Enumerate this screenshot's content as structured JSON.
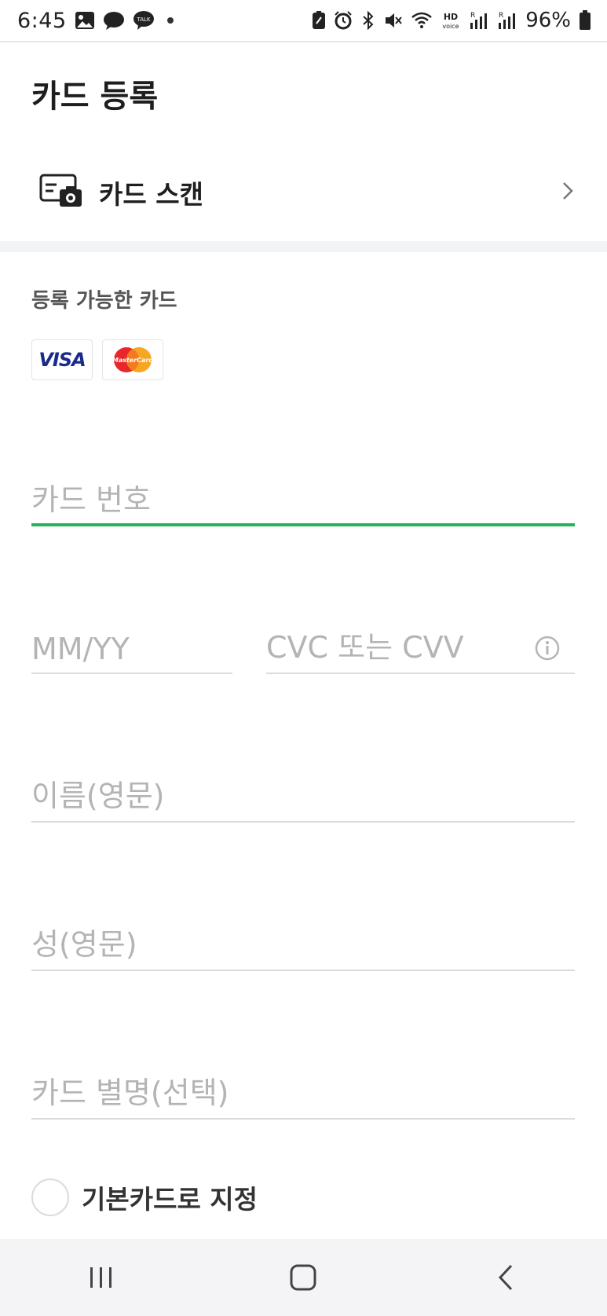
{
  "status_bar": {
    "time": "6:45",
    "battery_percent": "96%",
    "icons_left": [
      "gallery-icon",
      "chat-bubble-icon",
      "kakaotalk-icon"
    ],
    "kakaotalk_label": "TALK",
    "icons_right": [
      "phone-manager-icon",
      "alarm-icon",
      "bluetooth-icon",
      "mute-icon",
      "wifi-icon",
      "hd-voice-icon",
      "signal-icon",
      "signal-icon",
      "battery-icon"
    ],
    "hd_label": "HD",
    "voice_label": "voice",
    "signal_mark": "R"
  },
  "header": {
    "title": "카드 등록"
  },
  "scan": {
    "label": "카드 스캔",
    "icon": "card-camera-icon"
  },
  "accepted_cards": {
    "label": "등록 가능한 카드",
    "visa_label": "VISA",
    "mastercard_label": "MasterCard"
  },
  "form": {
    "card_number_placeholder": "카드 번호",
    "expiry_placeholder": "MM/YY",
    "cvc_placeholder": "CVC 또는 CVV",
    "first_name_placeholder": "이름(영문)",
    "last_name_placeholder": "성(영문)",
    "nickname_placeholder": "카드 별명(선택)",
    "default_card_label": "기본카드로 지정"
  },
  "colors": {
    "accent": "#22b45c",
    "placeholder": "#b4b4b4",
    "divider": "#f2f3f5"
  }
}
